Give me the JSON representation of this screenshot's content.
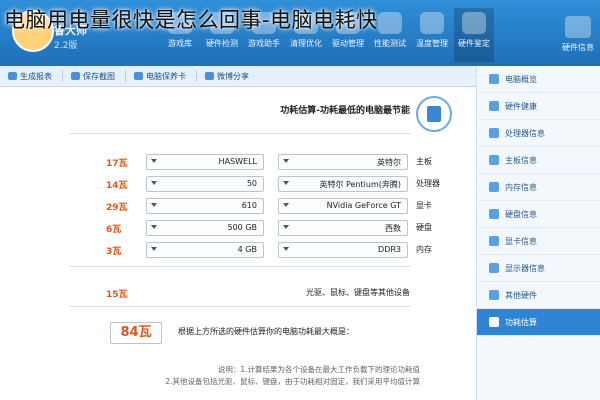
{
  "page_title": "电脑用电量很快是怎么回事-电脑电耗快",
  "header": {
    "app_name": "鲁大师",
    "app_sub": "2.2版",
    "nav": [
      {
        "label": "游戏库"
      },
      {
        "label": "硬件检测"
      },
      {
        "label": "游戏助手"
      },
      {
        "label": "清理优化"
      },
      {
        "label": "驱动管理"
      },
      {
        "label": "性能测试"
      },
      {
        "label": "温度管理"
      },
      {
        "label": "硬件鉴定"
      }
    ],
    "right_label": "硬件信息"
  },
  "toolbar": {
    "items": [
      {
        "label": "生成报表"
      },
      {
        "label": "保存截图"
      },
      {
        "label": "电脑保养卡"
      },
      {
        "label": "微博分享"
      }
    ]
  },
  "sidebar": {
    "items": [
      {
        "label": "电脑概览",
        "active": false
      },
      {
        "label": "硬件健康",
        "active": false
      },
      {
        "label": "处理器信息",
        "active": false
      },
      {
        "label": "主板信息",
        "active": false
      },
      {
        "label": "内存信息",
        "active": false
      },
      {
        "label": "硬盘信息",
        "active": false
      },
      {
        "label": "显卡信息",
        "active": false
      },
      {
        "label": "显示器信息",
        "active": false
      },
      {
        "label": "其他硬件",
        "active": false
      },
      {
        "label": "功耗估算",
        "active": true
      }
    ]
  },
  "main": {
    "section_title": "功耗估算-功耗最低的电脑最节能",
    "rows": [
      {
        "price": "17瓦",
        "select1": "HASWELL",
        "select2": "英特尔",
        "label": "主板"
      },
      {
        "price": "14瓦",
        "select1": "50",
        "select2": "英特尔 Pentium(奔腾)",
        "label": "处理器"
      },
      {
        "price": "29瓦",
        "select1": "610",
        "select2": "NVidia GeForce GT",
        "label": "显卡"
      },
      {
        "price": "6瓦",
        "select1": "500 GB",
        "select2": "西数",
        "label": "硬盘"
      },
      {
        "price": "3瓦",
        "select1": "4 GB",
        "select2": "DDR3",
        "label": "内存"
      }
    ],
    "peripheral_price": "15瓦",
    "peripheral_text": "光驱、鼠标、键盘等其他设备",
    "result_value": "84瓦",
    "result_text": "根据上方所选的硬件估算你的电脑功耗最大概是：",
    "notes_line1": "说明：1.计算结果为各个设备在最大工作负载下的理论功耗值",
    "notes_line2": "2.其他设备包括光驱、鼠标、键盘，由于功耗相对固定，我们采用平均值计算"
  },
  "colors": {
    "header_blue": "#2f8fd8",
    "accent_orange": "#e0561c",
    "active_sidebar": "#2f85d5"
  }
}
